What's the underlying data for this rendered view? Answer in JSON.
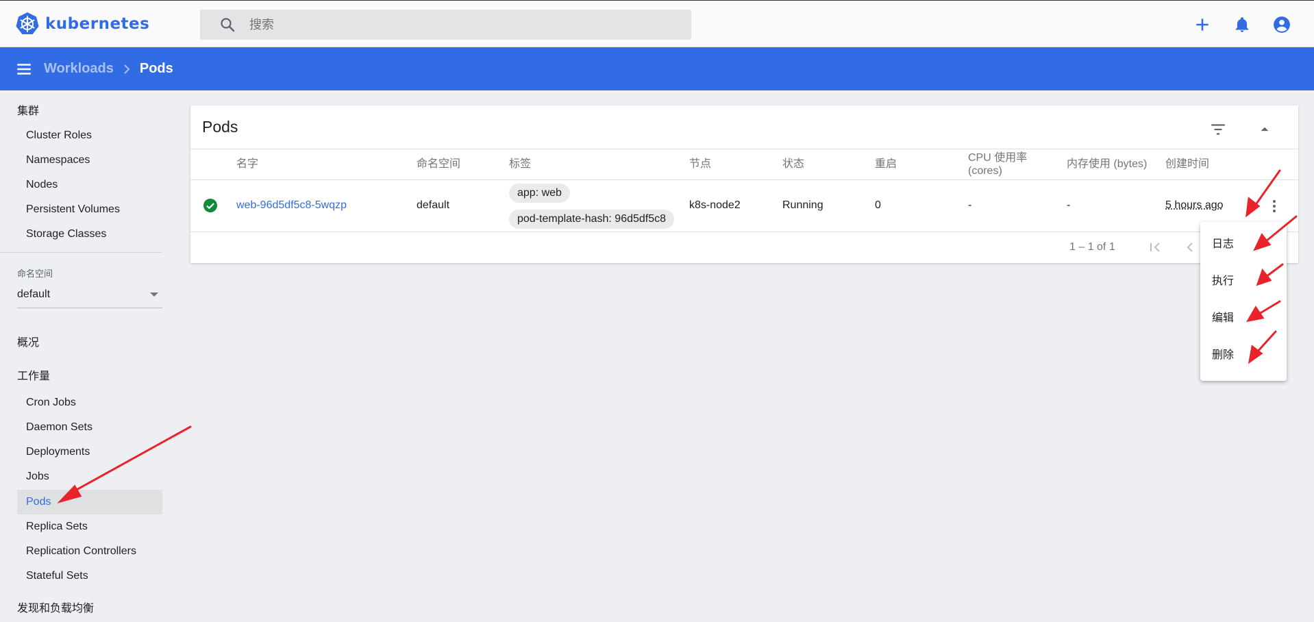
{
  "app": {
    "logo_text": "kubernetes"
  },
  "search": {
    "placeholder": "搜索"
  },
  "breadcrumb": {
    "parent": "Workloads",
    "current": "Pods"
  },
  "sidebar": {
    "cluster_heading": "集群",
    "cluster_items": [
      "Cluster Roles",
      "Namespaces",
      "Nodes",
      "Persistent Volumes",
      "Storage Classes"
    ],
    "namespace_label": "命名空间",
    "namespace_value": "default",
    "overview": "概况",
    "workloads_heading": "工作量",
    "workload_items": [
      "Cron Jobs",
      "Daemon Sets",
      "Deployments",
      "Jobs",
      "Pods",
      "Replica Sets",
      "Replication Controllers",
      "Stateful Sets"
    ],
    "active_item": "Pods",
    "discovery_heading": "发现和负载均衡"
  },
  "card": {
    "title": "Pods",
    "columns": [
      "名字",
      "命名空间",
      "标签",
      "节点",
      "状态",
      "重启",
      "CPU 使用率 (cores)",
      "内存使用 (bytes)",
      "创建时间"
    ],
    "rows": [
      {
        "name": "web-96d5df5c8-5wqzp",
        "namespace": "default",
        "labels": [
          "app: web",
          "pod-template-hash: 96d5df5c8"
        ],
        "node": "k8s-node2",
        "status": "Running",
        "restarts": "0",
        "cpu": "-",
        "memory": "-",
        "created": "5 hours ago"
      }
    ],
    "pagination": "1 – 1 of 1"
  },
  "context_menu": {
    "items": [
      "日志",
      "执行",
      "编辑",
      "删除"
    ]
  },
  "colors": {
    "brand": "#326ce5",
    "running": "#0f8a39",
    "annotation_arrow": "#e8232b"
  },
  "icons": [
    "kubernetes-logo-icon",
    "search-icon",
    "add-icon",
    "notifications-icon",
    "account-icon",
    "menu-icon",
    "chevron-right-icon",
    "filter-icon",
    "collapse-icon",
    "check-circle-icon",
    "more-vert-icon",
    "first-page-icon",
    "previous-page-icon"
  ]
}
